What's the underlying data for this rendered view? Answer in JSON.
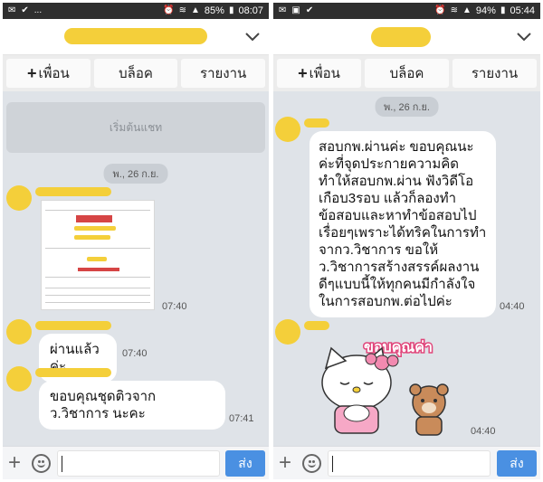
{
  "left": {
    "status": {
      "icons": [
        "mail-icon",
        "sticker-icon",
        "more-icon"
      ],
      "more_text": "...",
      "battery": "85%",
      "clock": "08:07"
    },
    "actions": {
      "add_friend": "เพื่อน",
      "block": "บล็อค",
      "report": "รายงาน"
    },
    "start_chat": "เริ่มต้นแชท",
    "date": "พ., 26 ก.ย.",
    "messages": [
      {
        "type": "image",
        "time": "07:40"
      },
      {
        "text": "ผ่านแล้วค่ะ",
        "time": "07:40"
      },
      {
        "text": "ขอบคุณชุดติวจากว.วิชาการ นะคะ",
        "time": "07:41"
      }
    ],
    "send_label": "ส่ง"
  },
  "right": {
    "status": {
      "battery": "94%",
      "clock": "05:44"
    },
    "actions": {
      "add_friend": "เพื่อน",
      "block": "บล็อค",
      "report": "รายงาน"
    },
    "date": "พ., 26 ก.ย.",
    "messages": [
      {
        "text": "สอบกพ.ผ่านค่ะ ขอบคุณนะค่ะที่จุดประกายความคิด ทำให้สอบกพ.ผ่าน ฟังวิดีโอเกือบ3รอบ แล้วก็ลองทำข้อสอบและหาทำข้อสอบไปเรื่อยๆเพราะได้ทริคในการทำจากว.วิชาการ ขอให้ว.วิชาการสร้างสรรค์ผลงานดีๆแบบนี้ให้ทุกคนมีกำลังใจในการสอบกพ.ต่อไปค่ะ",
        "time": "04:40"
      },
      {
        "type": "sticker",
        "sticker_text": "ขอบคุณค่า",
        "time": "04:40"
      }
    ],
    "send_label": "ส่ง"
  },
  "colors": {
    "accent": "#4a90e2",
    "highlight": "#f4cf3a",
    "chat_bg": "#dfe3e8"
  }
}
